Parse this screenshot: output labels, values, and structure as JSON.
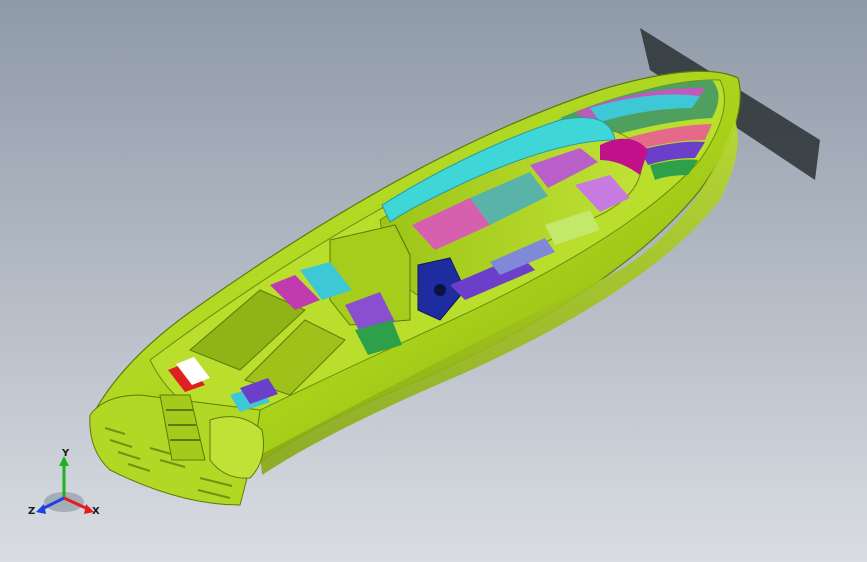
{
  "view": {
    "background_top": "#8f9aa8",
    "background_bottom": "#d9dde2"
  },
  "model": {
    "hull_color": "#a8d21a",
    "hull_shadow": "#7fa010",
    "cushion_colors": [
      "#d65fb0",
      "#5ab3a8",
      "#b85fc9",
      "#8a4fd0",
      "#3ec8d6"
    ]
  },
  "triad": {
    "x_label": "X",
    "y_label": "Y",
    "z_label": "Z",
    "x_color": "#e02020",
    "y_color": "#20b020",
    "z_color": "#2040e0"
  }
}
